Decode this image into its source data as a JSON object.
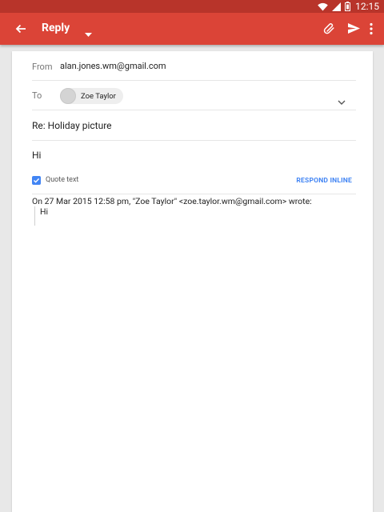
{
  "status_bar": {
    "time": "12:15",
    "icons": [
      "wifi-icon",
      "signal-icon",
      "battery-icon"
    ]
  },
  "app_bar": {
    "title": "Reply",
    "color": "#db4437",
    "icons": [
      "back-arrow-icon",
      "dropdown-caret-icon",
      "attach-icon",
      "send-icon",
      "more-vert-icon"
    ]
  },
  "compose": {
    "from_label": "From",
    "from_value": "alan.jones.wm@gmail.com",
    "to_label": "To",
    "to_recipient": "Zoe Taylor",
    "subject": "Re: Holiday picture",
    "body": "Hi"
  },
  "quote": {
    "checked": true,
    "label": "Quote text",
    "respond_inline": "RESPOND INLINE",
    "header": "On 27 Mar 2015 12:58 pm, \"Zoe Taylor\" <zoe.taylor.wm@gmail.com> wrote:",
    "body": "Hi"
  },
  "colors": {
    "accent_blue": "#4285f4",
    "status_bar": "#b8342a"
  }
}
